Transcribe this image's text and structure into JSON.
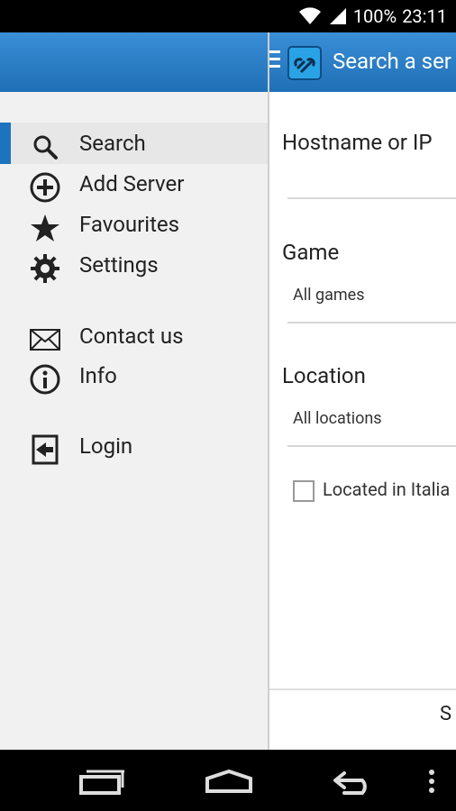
{
  "status": {
    "battery": "100%",
    "time": "23:11"
  },
  "drawer": {
    "items": [
      {
        "label": "Search",
        "icon": "search-icon"
      },
      {
        "label": "Add Server",
        "icon": "add-circle-icon"
      },
      {
        "label": "Favourites",
        "icon": "star-icon"
      },
      {
        "label": "Settings",
        "icon": "gear-icon"
      },
      {
        "label": "Contact us",
        "icon": "mail-icon"
      },
      {
        "label": "Info",
        "icon": "info-icon"
      },
      {
        "label": "Login",
        "icon": "login-icon"
      }
    ]
  },
  "appbar": {
    "title": "Search a ser"
  },
  "form": {
    "hostname_label": "Hostname or IP",
    "game_label": "Game",
    "game_value": "All games",
    "location_label": "Location",
    "location_value": "All locations",
    "checkbox_label": "Located in Italia"
  },
  "bottom": {
    "button_label": "S"
  },
  "colors": {
    "accent": "#1E73BE",
    "header_top": "#3A8FD6",
    "header_bottom": "#1F6FB6"
  }
}
